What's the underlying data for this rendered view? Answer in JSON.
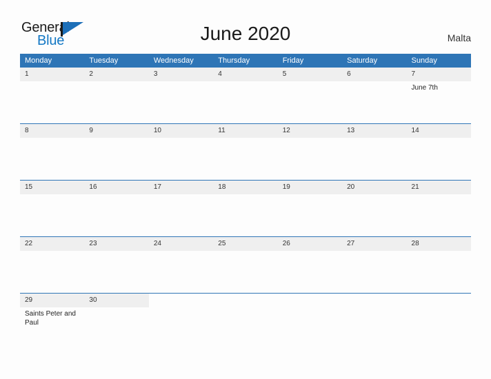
{
  "brand": {
    "name_part1": "General",
    "name_part2": "Blue",
    "mark_icon": "flag-triangle-icon",
    "accent_color": "#1277c4"
  },
  "header": {
    "title": "June 2020",
    "country": "Malta"
  },
  "theme": {
    "header_blue": "#2e75b6",
    "row_band_gray": "#efefef",
    "page_background": "#fdfdfd",
    "text_color": "#333333"
  },
  "calendar": {
    "weekdays": [
      "Monday",
      "Tuesday",
      "Wednesday",
      "Thursday",
      "Friday",
      "Saturday",
      "Sunday"
    ],
    "weeks": [
      [
        {
          "day": "1",
          "holiday": ""
        },
        {
          "day": "2",
          "holiday": ""
        },
        {
          "day": "3",
          "holiday": ""
        },
        {
          "day": "4",
          "holiday": ""
        },
        {
          "day": "5",
          "holiday": ""
        },
        {
          "day": "6",
          "holiday": ""
        },
        {
          "day": "7",
          "holiday": "June 7th"
        }
      ],
      [
        {
          "day": "8",
          "holiday": ""
        },
        {
          "day": "9",
          "holiday": ""
        },
        {
          "day": "10",
          "holiday": ""
        },
        {
          "day": "11",
          "holiday": ""
        },
        {
          "day": "12",
          "holiday": ""
        },
        {
          "day": "13",
          "holiday": ""
        },
        {
          "day": "14",
          "holiday": ""
        }
      ],
      [
        {
          "day": "15",
          "holiday": ""
        },
        {
          "day": "16",
          "holiday": ""
        },
        {
          "day": "17",
          "holiday": ""
        },
        {
          "day": "18",
          "holiday": ""
        },
        {
          "day": "19",
          "holiday": ""
        },
        {
          "day": "20",
          "holiday": ""
        },
        {
          "day": "21",
          "holiday": ""
        }
      ],
      [
        {
          "day": "22",
          "holiday": ""
        },
        {
          "day": "23",
          "holiday": ""
        },
        {
          "day": "24",
          "holiday": ""
        },
        {
          "day": "25",
          "holiday": ""
        },
        {
          "day": "26",
          "holiday": ""
        },
        {
          "day": "27",
          "holiday": ""
        },
        {
          "day": "28",
          "holiday": ""
        }
      ],
      [
        {
          "day": "29",
          "holiday": "Saints Peter and Paul"
        },
        {
          "day": "30",
          "holiday": ""
        },
        {
          "day": "",
          "holiday": ""
        },
        {
          "day": "",
          "holiday": ""
        },
        {
          "day": "",
          "holiday": ""
        },
        {
          "day": "",
          "holiday": ""
        },
        {
          "day": "",
          "holiday": ""
        }
      ]
    ]
  }
}
